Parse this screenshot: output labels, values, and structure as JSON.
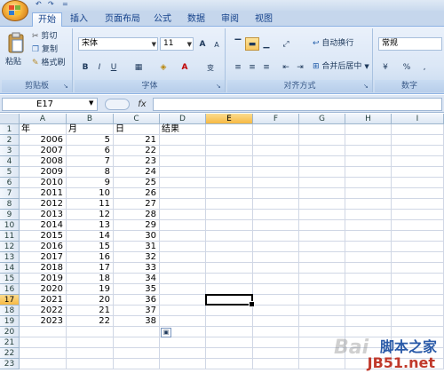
{
  "quick_access": {
    "undo": "↶",
    "redo": "↷",
    "customize": "="
  },
  "tabs": [
    {
      "label": "开始",
      "active": true
    },
    {
      "label": "插入"
    },
    {
      "label": "页面布局"
    },
    {
      "label": "公式"
    },
    {
      "label": "数据"
    },
    {
      "label": "审阅"
    },
    {
      "label": "视图"
    }
  ],
  "ribbon": {
    "clipboard": {
      "label": "剪贴板",
      "paste": "粘贴",
      "cut": "剪切",
      "copy": "复制",
      "format_painter": "格式刷"
    },
    "font": {
      "label": "字体",
      "font_name": "宋体",
      "font_size": "11",
      "grow": "A",
      "shrink": "A",
      "bold": "B",
      "italic": "I",
      "underline": "U",
      "font_color_letter": "A",
      "phonetic": "变"
    },
    "alignment": {
      "label": "对齐方式",
      "wrap_text": "自动换行",
      "merge_center": "合并后居中"
    },
    "number": {
      "label": "数字",
      "format": "常规",
      "percent": "%",
      "comma": ","
    }
  },
  "formula_bar": {
    "name_box": "E17",
    "fx": "fx",
    "formula": ""
  },
  "sheet": {
    "columns": [
      "A",
      "B",
      "C",
      "D",
      "E",
      "F",
      "G",
      "H",
      "I"
    ],
    "active_column": "E",
    "active_row": 17,
    "rows": [
      {
        "n": 1,
        "A": "年",
        "B": "月",
        "C": "日",
        "D": "结果"
      },
      {
        "n": 2,
        "A": "2006",
        "B": "5",
        "C": "21"
      },
      {
        "n": 3,
        "A": "2007",
        "B": "6",
        "C": "22"
      },
      {
        "n": 4,
        "A": "2008",
        "B": "7",
        "C": "23"
      },
      {
        "n": 5,
        "A": "2009",
        "B": "8",
        "C": "24"
      },
      {
        "n": 6,
        "A": "2010",
        "B": "9",
        "C": "25"
      },
      {
        "n": 7,
        "A": "2011",
        "B": "10",
        "C": "26"
      },
      {
        "n": 8,
        "A": "2012",
        "B": "11",
        "C": "27"
      },
      {
        "n": 9,
        "A": "2013",
        "B": "12",
        "C": "28"
      },
      {
        "n": 10,
        "A": "2014",
        "B": "13",
        "C": "29"
      },
      {
        "n": 11,
        "A": "2015",
        "B": "14",
        "C": "30"
      },
      {
        "n": 12,
        "A": "2016",
        "B": "15",
        "C": "31"
      },
      {
        "n": 13,
        "A": "2017",
        "B": "16",
        "C": "32"
      },
      {
        "n": 14,
        "A": "2018",
        "B": "17",
        "C": "33"
      },
      {
        "n": 15,
        "A": "2019",
        "B": "18",
        "C": "34"
      },
      {
        "n": 16,
        "A": "2020",
        "B": "19",
        "C": "35"
      },
      {
        "n": 17,
        "A": "2021",
        "B": "20",
        "C": "36"
      },
      {
        "n": 18,
        "A": "2022",
        "B": "21",
        "C": "37"
      },
      {
        "n": 19,
        "A": "2023",
        "B": "22",
        "C": "38"
      },
      {
        "n": 20
      },
      {
        "n": 21
      },
      {
        "n": 22
      },
      {
        "n": 23
      }
    ]
  },
  "watermark": {
    "brand": "脚本之家",
    "site": "JB51.net",
    "bg": "Bai"
  }
}
